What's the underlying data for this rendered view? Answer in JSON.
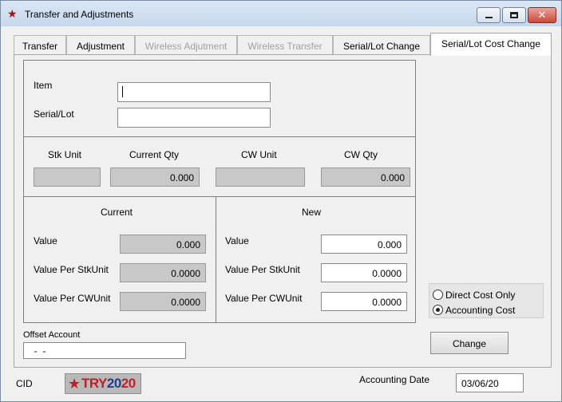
{
  "window": {
    "title": "Transfer and Adjustments",
    "close_glyph": "✕"
  },
  "tabs": [
    {
      "label": "Transfer",
      "state": "normal"
    },
    {
      "label": "Adjustment",
      "state": "normal"
    },
    {
      "label": "Wireless Adjutment",
      "state": "disabled"
    },
    {
      "label": "Wireless Transfer",
      "state": "disabled"
    },
    {
      "label": "Serial/Lot Change",
      "state": "normal"
    },
    {
      "label": "Serial/Lot Cost Change",
      "state": "active"
    }
  ],
  "item": {
    "label": "Item",
    "value": ""
  },
  "serial_lot": {
    "label": "Serial/Lot",
    "value": ""
  },
  "quantities": {
    "stk_unit": {
      "label": "Stk Unit",
      "value": ""
    },
    "current_qty": {
      "label": "Current Qty",
      "value": "0.000"
    },
    "cw_unit": {
      "label": "CW Unit",
      "value": ""
    },
    "cw_qty": {
      "label": "CW Qty",
      "value": "0.000"
    }
  },
  "current": {
    "heading": "Current",
    "value_label": "Value",
    "value": "0.000",
    "per_stk_label": "Value Per StkUnit",
    "per_stk": "0.0000",
    "per_cw_label": "Value Per CWUnit",
    "per_cw": "0.0000"
  },
  "new": {
    "heading": "New",
    "value_label": "Value",
    "value": "0.000",
    "per_stk_label": "Value Per StkUnit",
    "per_stk": "0.0000",
    "per_cw_label": "Value Per CWUnit",
    "per_cw": "0.0000"
  },
  "cost_mode": {
    "options": [
      {
        "label": "Direct Cost Only",
        "checked": false
      },
      {
        "label": "Accounting Cost",
        "checked": true
      }
    ]
  },
  "offset_account": {
    "label": "Offset Account",
    "value": "  -  -"
  },
  "change_button": {
    "label": "Change"
  },
  "footer": {
    "cid_label": "CID",
    "logo_try": "TRY",
    "logo_year": "20",
    "logo_year2": "20",
    "accounting_date_label": "Accounting Date",
    "accounting_date": "03/06/20"
  },
  "colors": {
    "logo_red": "#c0202a",
    "logo_blue": "#1f3f8f"
  }
}
